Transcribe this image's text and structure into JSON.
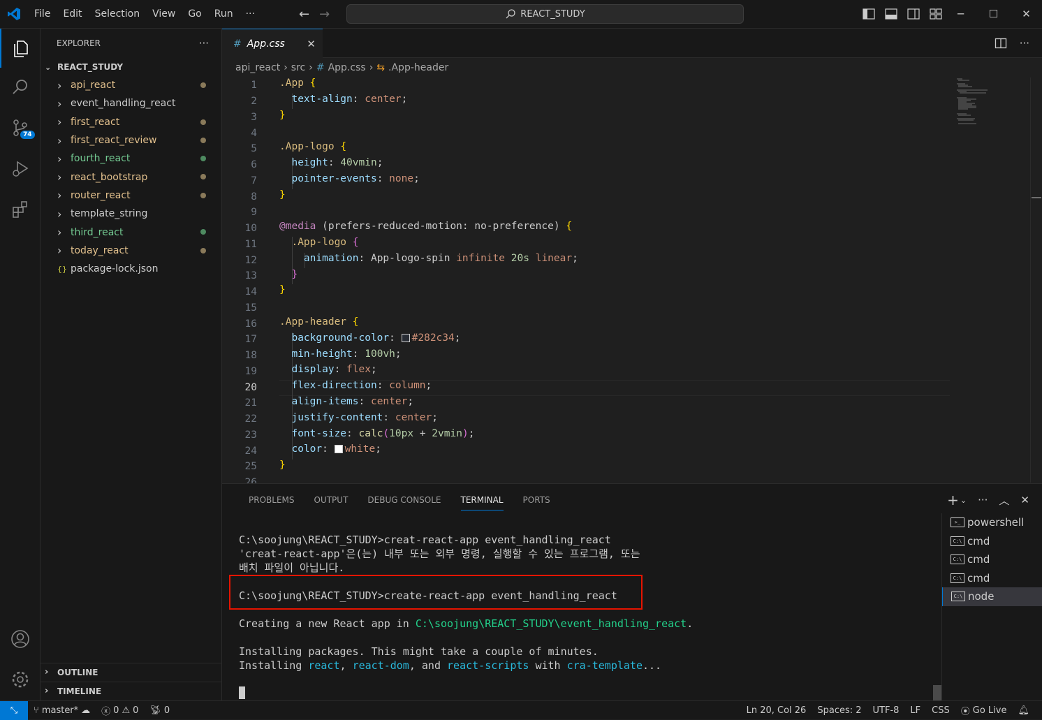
{
  "titlebar": {
    "menu": [
      "File",
      "Edit",
      "Selection",
      "View",
      "Go",
      "Run",
      "···"
    ],
    "command_center": "REACT_STUDY"
  },
  "activity": {
    "scm_badge": "74"
  },
  "sidebar": {
    "title": "EXPLORER",
    "more": "···",
    "root": "REACT_STUDY",
    "items": [
      {
        "label": "api_react",
        "color": "#e2c08d",
        "dot": "#8a7a5a"
      },
      {
        "label": "event_handling_react",
        "color": "#cccccc",
        "dot": ""
      },
      {
        "label": "first_react",
        "color": "#e2c08d",
        "dot": "#8a7a5a"
      },
      {
        "label": "first_react_review",
        "color": "#e2c08d",
        "dot": "#8a7a5a"
      },
      {
        "label": "fourth_react",
        "color": "#73c991",
        "dot": "#4e8a60"
      },
      {
        "label": "react_bootstrap",
        "color": "#e2c08d",
        "dot": "#8a7a5a"
      },
      {
        "label": "router_react",
        "color": "#e2c08d",
        "dot": "#8a7a5a"
      },
      {
        "label": "template_string",
        "color": "#cccccc",
        "dot": ""
      },
      {
        "label": "third_react",
        "color": "#73c991",
        "dot": "#4e8a60"
      },
      {
        "label": "today_react",
        "color": "#e2c08d",
        "dot": "#8a7a5a"
      },
      {
        "label": "package-lock.json",
        "color": "#cccccc",
        "dot": "",
        "file": true
      }
    ],
    "outline": "OUTLINE",
    "timeline": "TIMELINE"
  },
  "editor": {
    "tab_label": "App.css",
    "breadcrumb": [
      "api_react",
      "src",
      "App.css",
      ".App-header"
    ],
    "current_line": 20,
    "lines": [
      "1",
      "2",
      "3",
      "4",
      "5",
      "6",
      "7",
      "8",
      "9",
      "10",
      "11",
      "12",
      "13",
      "14",
      "15",
      "16",
      "17",
      "18",
      "19",
      "20",
      "21",
      "22",
      "23",
      "24",
      "25",
      "26"
    ],
    "code": {
      "l1_sel": ".App",
      "l1_brace": "{",
      "l2_prop": "text-align",
      "l2_val": "center",
      "l3": "}",
      "l5_sel": ".App-logo",
      "l5_brace": "{",
      "l6_prop": "height",
      "l6_val": "40vmin",
      "l7_prop": "pointer-events",
      "l7_val": "none",
      "l8": "}",
      "l10_kw": "@media",
      "l10_text": "(prefers-reduced-motion: no-preference)",
      "l10_brace": "{",
      "l11_sel": ".App-logo",
      "l11_brace": "{",
      "l12_prop": "animation",
      "l12_a": "App-logo-spin",
      "l12_b": "infinite",
      "l12_c": "20s",
      "l12_d": "linear",
      "l13": "}",
      "l14": "}",
      "l16_sel": ".App-header",
      "l16_brace": "{",
      "l17_prop": "background-color",
      "l17_val": "#282c34",
      "l18_prop": "min-height",
      "l18_val": "100vh",
      "l19_prop": "display",
      "l19_val": "flex",
      "l20_prop": "flex-direction",
      "l20_val": "column",
      "l21_prop": "align-items",
      "l21_val": "center",
      "l22_prop": "justify-content",
      "l22_val": "center",
      "l23_prop": "font-size",
      "l23_fn": "calc",
      "l23_a": "10px",
      "l23_op": "+",
      "l23_b": "2vmin",
      "l24_prop": "color",
      "l24_val": "white",
      "l25": "}"
    },
    "colors": {
      "swatch_dark": "#282c34",
      "swatch_white": "#ffffff"
    }
  },
  "panel": {
    "tabs": [
      "PROBLEMS",
      "OUTPUT",
      "DEBUG CONSOLE",
      "TERMINAL",
      "PORTS"
    ],
    "active_tab": "TERMINAL",
    "terminal": {
      "l1": "C:\\soojung\\REACT_STUDY>creat-react-app event_handling_react",
      "l2": "'creat-react-app'은(는) 내부 또는 외부 명령, 실행할 수 있는 프로그램, 또는",
      "l3": "배치 파일이 아닙니다.",
      "l4": "C:\\soojung\\REACT_STUDY>create-react-app event_handling_react",
      "l5_a": "Creating a new React app in ",
      "l5_path": "C:\\soojung\\REACT_STUDY\\event_handling_react",
      "l5_end": ".",
      "l6": "Installing packages. This might take a couple of minutes.",
      "l7_a": "Installing ",
      "l7_p1": "react",
      "l7_s1": ", ",
      "l7_p2": "react-dom",
      "l7_s2": ", and ",
      "l7_p3": "react-scripts",
      "l7_s3": " with ",
      "l7_p4": "cra-template",
      "l7_end": "..."
    },
    "terminals": [
      {
        "label": "powershell",
        "icon": ">_"
      },
      {
        "label": "cmd",
        "icon": "C:\\"
      },
      {
        "label": "cmd",
        "icon": "C:\\"
      },
      {
        "label": "cmd",
        "icon": "C:\\"
      },
      {
        "label": "node",
        "icon": "C:\\"
      }
    ]
  },
  "status": {
    "branch": "master*",
    "errors": "0",
    "warnings": "0",
    "ports": "0",
    "position": "Ln 20, Col 26",
    "spaces": "Spaces: 2",
    "encoding": "UTF-8",
    "eol": "LF",
    "language": "CSS",
    "golive": "Go Live"
  }
}
